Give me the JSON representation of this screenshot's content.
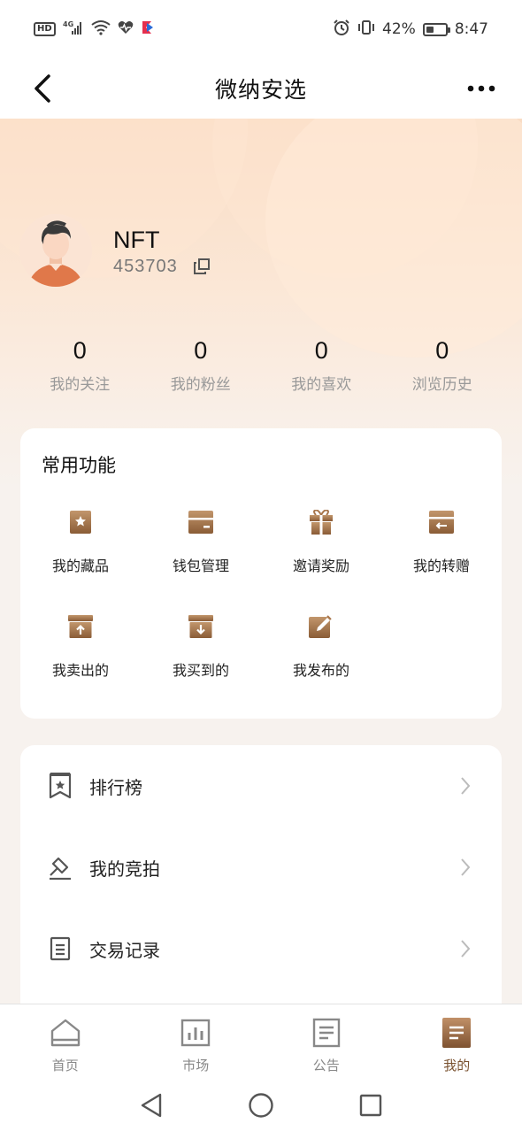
{
  "status_bar": {
    "network": "4G",
    "hd_label": "HD",
    "battery_percent": "42%",
    "battery_level": 0.42,
    "time": "8:47",
    "icons": [
      "hd-icon",
      "signal-icon",
      "wifi-icon",
      "heart-icon",
      "app-icon",
      "alarm-icon",
      "vibrate-icon",
      "battery-icon"
    ]
  },
  "nav": {
    "title": "微纳安选",
    "back_icon": "chevron-left-icon",
    "more_icon": "more-dots-icon"
  },
  "profile": {
    "name": "NFT",
    "id": "453703",
    "copy_icon": "copy-icon"
  },
  "stats": [
    {
      "value": "0",
      "label": "我的关注"
    },
    {
      "value": "0",
      "label": "我的粉丝"
    },
    {
      "value": "0",
      "label": "我的喜欢"
    },
    {
      "value": "0",
      "label": "浏览历史"
    }
  ],
  "functions": {
    "title": "常用功能",
    "items": [
      {
        "label": "我的藏品",
        "icon": "collection-star-icon"
      },
      {
        "label": "钱包管理",
        "icon": "wallet-icon"
      },
      {
        "label": "邀请奖励",
        "icon": "gift-icon"
      },
      {
        "label": "我的转赠",
        "icon": "transfer-icon"
      },
      {
        "label": "我卖出的",
        "icon": "box-upload-icon"
      },
      {
        "label": "我买到的",
        "icon": "box-download-icon"
      },
      {
        "label": "我发布的",
        "icon": "edit-icon"
      }
    ]
  },
  "menu": [
    {
      "label": "排行榜",
      "icon": "ranking-bookmark-icon"
    },
    {
      "label": "我的竞拍",
      "icon": "auction-hammer-icon"
    },
    {
      "label": "交易记录",
      "icon": "document-list-icon"
    }
  ],
  "tabs": [
    {
      "label": "首页",
      "icon": "home-icon",
      "active": false
    },
    {
      "label": "市场",
      "icon": "chart-icon",
      "active": false
    },
    {
      "label": "公告",
      "icon": "notice-icon",
      "active": false
    },
    {
      "label": "我的",
      "icon": "profile-doc-icon",
      "active": true
    }
  ],
  "colors": {
    "accent": "#7a5230",
    "icon_brown": "#a9774d",
    "header_gradient_top": "#f9dcc4"
  }
}
